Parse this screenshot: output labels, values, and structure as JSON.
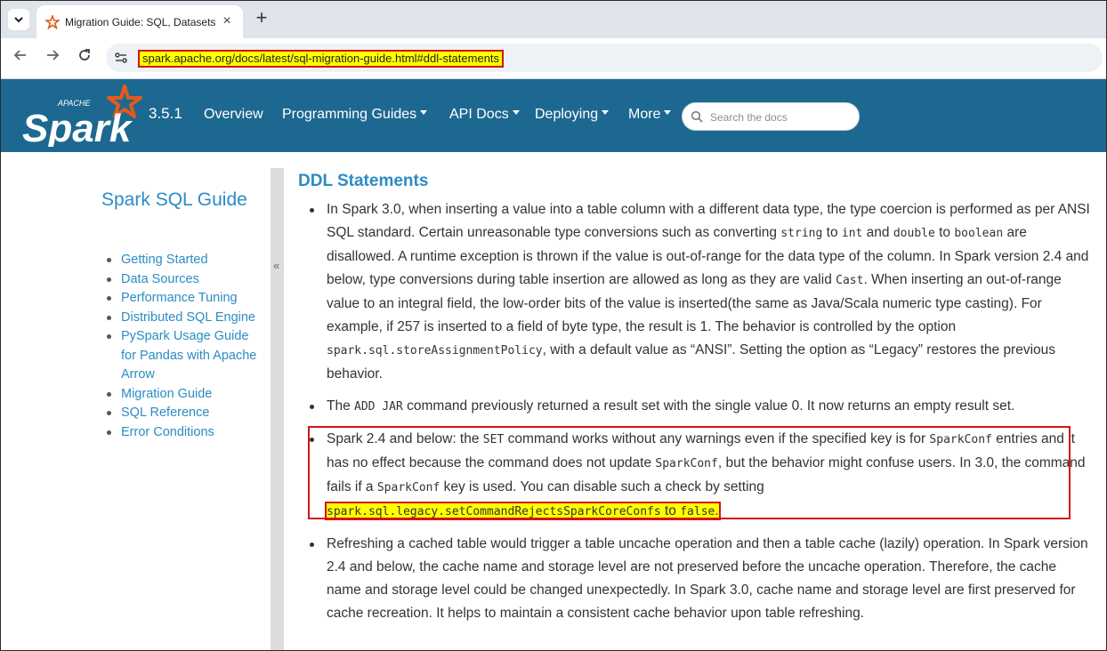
{
  "browser": {
    "tab_title": "Migration Guide: SQL, Datasets",
    "url": "spark.apache.org/docs/latest/sql-migration-guide.html#ddl-statements"
  },
  "header": {
    "logo_text": "Spark",
    "logo_top_text": "APACHE",
    "version": "3.5.1",
    "nav": {
      "overview": "Overview",
      "programming_guides": "Programming Guides",
      "api_docs": "API Docs",
      "deploying": "Deploying",
      "more": "More"
    },
    "search_placeholder": "Search the docs"
  },
  "sidebar": {
    "title": "Spark SQL Guide",
    "items": [
      {
        "label": "Getting Started"
      },
      {
        "label": "Data Sources"
      },
      {
        "label": "Performance Tuning"
      },
      {
        "label": "Distributed SQL Engine"
      },
      {
        "label": "PySpark Usage Guide for Pandas with Apache Arrow"
      },
      {
        "label": "Migration Guide"
      },
      {
        "label": "SQL Reference"
      },
      {
        "label": "Error Conditions"
      }
    ],
    "collapse_label": "«"
  },
  "main": {
    "section_title": "DDL Statements",
    "b1": {
      "t1": "In Spark 3.0, when inserting a value into a table column with a different data type, the type coercion is performed as per ANSI SQL standard. Certain unreasonable type conversions such as converting ",
      "c1": "string",
      "t2": " to ",
      "c2": "int",
      "t3": " and ",
      "c3": "double",
      "t4": " to ",
      "c4": "boolean",
      "t5": " are disallowed. A runtime exception is thrown if the value is out-of-range for the data type of the column. In Spark version 2.4 and below, type conversions during table insertion are allowed as long as they are valid ",
      "c5": "Cast",
      "t6": ". When inserting an out-of-range value to an integral field, the low-order bits of the value is inserted(the same as Java/Scala numeric type casting). For example, if 257 is inserted to a field of byte type, the result is 1. The behavior is controlled by the option ",
      "c6": "spark.sql.storeAssignmentPolicy",
      "t7": ", with a default value as “ANSI”. Setting the option as “Legacy” restores the previous behavior."
    },
    "b2": {
      "t1": "The ",
      "c1": "ADD JAR",
      "t2": " command previously returned a result set with the single value 0. It now returns an empty result set."
    },
    "b3": {
      "t1": "Spark 2.4 and below: the ",
      "c1": "SET",
      "t2": " command works without any warnings even if the specified key is for ",
      "c2": "SparkConf",
      "t3": " entries and it has no effect because the command does not update ",
      "c3": "SparkConf",
      "t4": ", but the behavior might confuse users. In 3.0, the command fails if a ",
      "c4": "SparkConf",
      "t5": " key is used. You can disable such a check by setting ",
      "c5": "spark.sql.legacy.setCommandRejectsSparkCoreConfs",
      "t6": " to ",
      "c6": "false",
      "t7": "."
    },
    "b4": {
      "t1": "Refreshing a cached table would trigger a table uncache operation and then a table cache (lazily) operation. In Spark version 2.4 and below, the cache name and storage level are not preserved before the uncache operation. Therefore, the cache name and storage level could be changed unexpectedly. In Spark 3.0, cache name and storage level are first preserved for cache recreation. It helps to maintain a consistent cache behavior upon table refreshing."
    }
  },
  "colors": {
    "header_bg": "#1d6890",
    "link": "#2b8cc4",
    "highlight": "#ffff00",
    "annotation_border": "#d11515",
    "logo_star": "#e25a1c"
  }
}
